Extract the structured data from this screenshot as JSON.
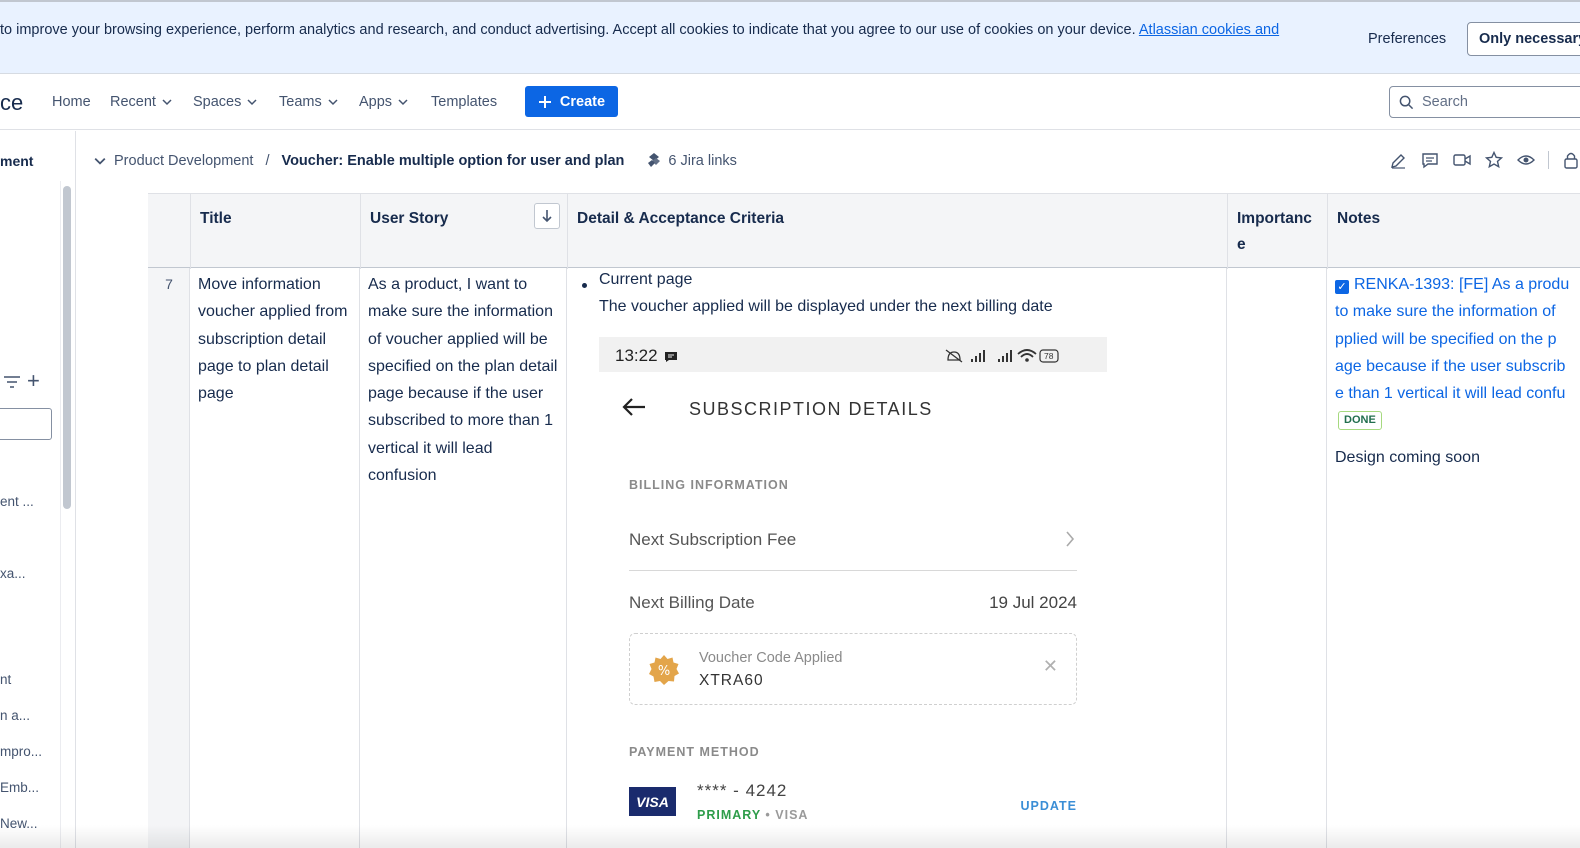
{
  "cookie": {
    "text": "to improve your browsing experience, perform analytics and research, and conduct advertising. Accept all cookies to indicate that you agree to our use of cookies on your device.",
    "link": "Atlassian cookies and",
    "preferences": "Preferences",
    "only_necessary": "Only necessary"
  },
  "nav": {
    "logo_fragment": "ce",
    "home": "Home",
    "recent": "Recent",
    "spaces": "Spaces",
    "teams": "Teams",
    "apps": "Apps",
    "templates": "Templates",
    "create": "Create",
    "search_placeholder": "Search"
  },
  "sidebar": {
    "header": "ment",
    "items": [
      "ent ...",
      "xa...",
      "nt",
      "n a...",
      "mpro...",
      "Emb...",
      "New..."
    ]
  },
  "breadcrumb": {
    "space": "Product Development",
    "separator": "/",
    "page": "Voucher: Enable multiple option for user and plan",
    "jira_links": "6 Jira links"
  },
  "table": {
    "headers": {
      "title": "Title",
      "user_story": "User Story",
      "detail": "Detail & Acceptance Criteria",
      "importance": "Importanc\ne",
      "notes": "Notes"
    },
    "row": {
      "number": "7",
      "title": "Move information voucher applied from subscription detail page to plan detail page",
      "user_story": "As a product, I want to make sure the information of voucher applied will be specified on the plan detail page because if the user subscribed to more than 1 vertical it will lead confusion",
      "detail_bullet": "Current page",
      "detail_text": "The voucher applied will be displayed under the next billing date",
      "notes_jira_lines": [
        "RENKA-1393: [FE] As a produ",
        "to make sure the information of",
        "pplied will be specified on the p",
        "age because if the user subscrib",
        "e than 1 vertical it will lead confu"
      ],
      "notes_status": "DONE",
      "notes_text": "Design coming soon"
    }
  },
  "phone": {
    "time": "13:22",
    "battery": "78",
    "title": "SUBSCRIPTION DETAILS",
    "billing_section": "BILLING INFORMATION",
    "next_fee": "Next Subscription Fee",
    "next_billing_label": "Next Billing Date",
    "next_billing_date": "19 Jul 2024",
    "voucher_label": "Voucher Code Applied",
    "voucher_code": "XTRA60",
    "payment_section": "PAYMENT METHOD",
    "card_brand": "VISA",
    "card_number": "**** - 4242",
    "card_primary": "PRIMARY",
    "card_type": " • VISA",
    "update": "UPDATE"
  },
  "colors": {
    "brand_blue": "#0c66e4",
    "banner_bg": "#e9f2ff",
    "done_green": "#216e4e"
  }
}
